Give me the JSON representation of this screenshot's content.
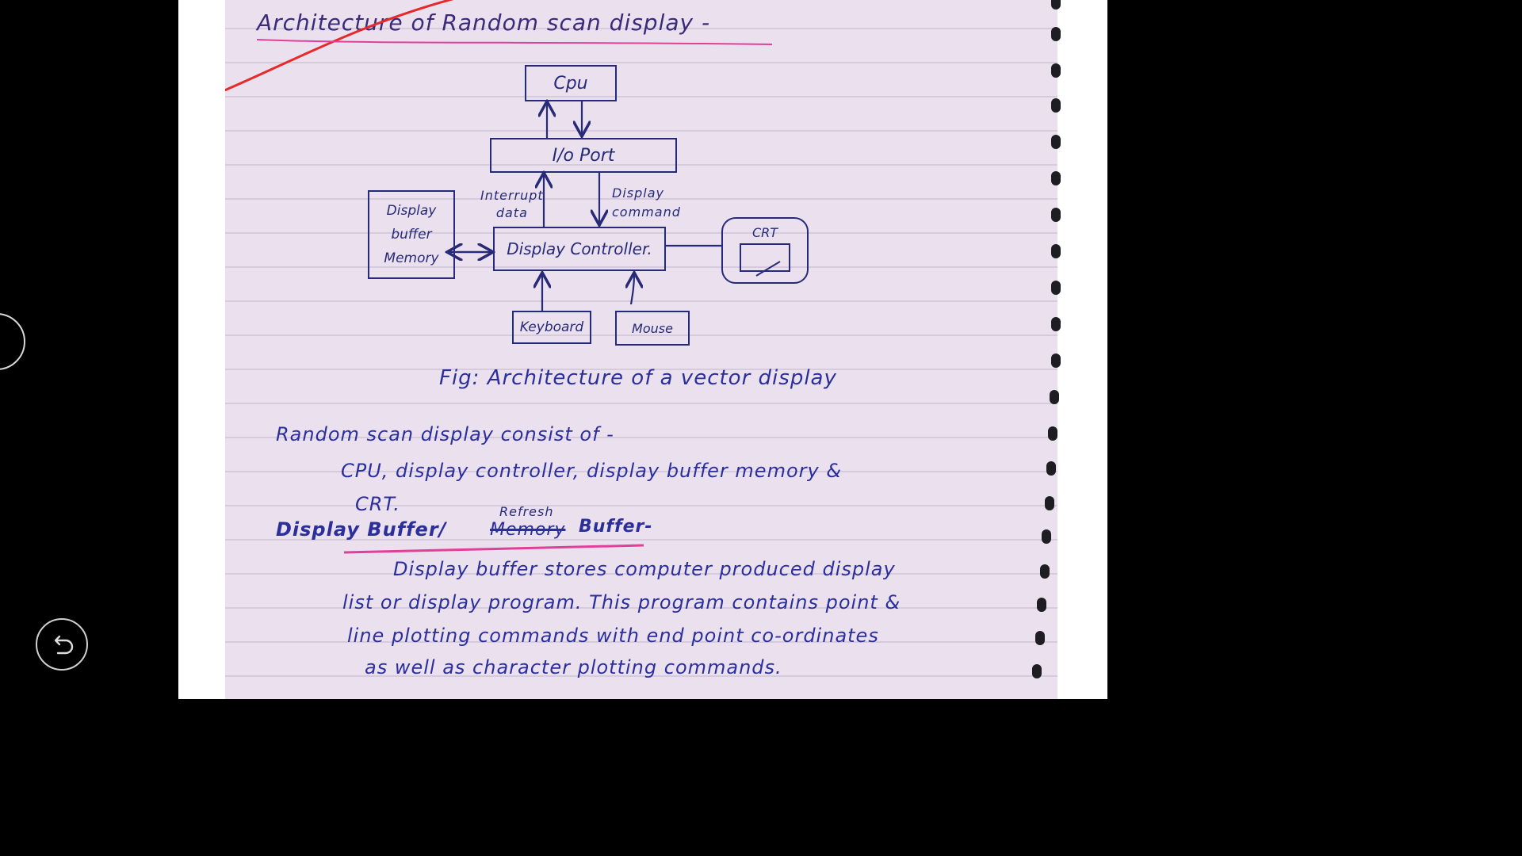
{
  "heading": {
    "title": "Architecture of Random scan display -"
  },
  "diagram": {
    "cpu": "Cpu",
    "io_port": "I/o Port",
    "interrupt_data": [
      "Interrupt",
      "data"
    ],
    "display_command": [
      "Display",
      "command"
    ],
    "display_buffer_memory": [
      "Display",
      "buffer",
      "Memory"
    ],
    "display_controller": "Display Controller.",
    "crt": "CRT",
    "keyboard": "Keyboard",
    "mouse": "Mouse",
    "caption": "Fig: Architecture of a vector display"
  },
  "notes": {
    "line1": "Random scan display consist of -",
    "line2": "CPU, display controller, display buffer memory &",
    "line3": "CRT.",
    "subheading_left": "Display Buffer/",
    "subheading_struck": "Memory",
    "subheading_refresh": "Refresh",
    "subheading_right": "Buffer-",
    "para1": "Display buffer stores computer produced display",
    "para2": "list or display program. This program contains point &",
    "para3": "line plotting commands with end point co-ordinates",
    "para4": "as well as character plotting commands."
  },
  "colors": {
    "ink": "#2a2f9c",
    "heading_ink": "#3a2b7a",
    "highlight_pink": "#e0409a",
    "red_mark": "#e42a2a"
  },
  "icons": {
    "back": "undo-arrow-icon"
  }
}
